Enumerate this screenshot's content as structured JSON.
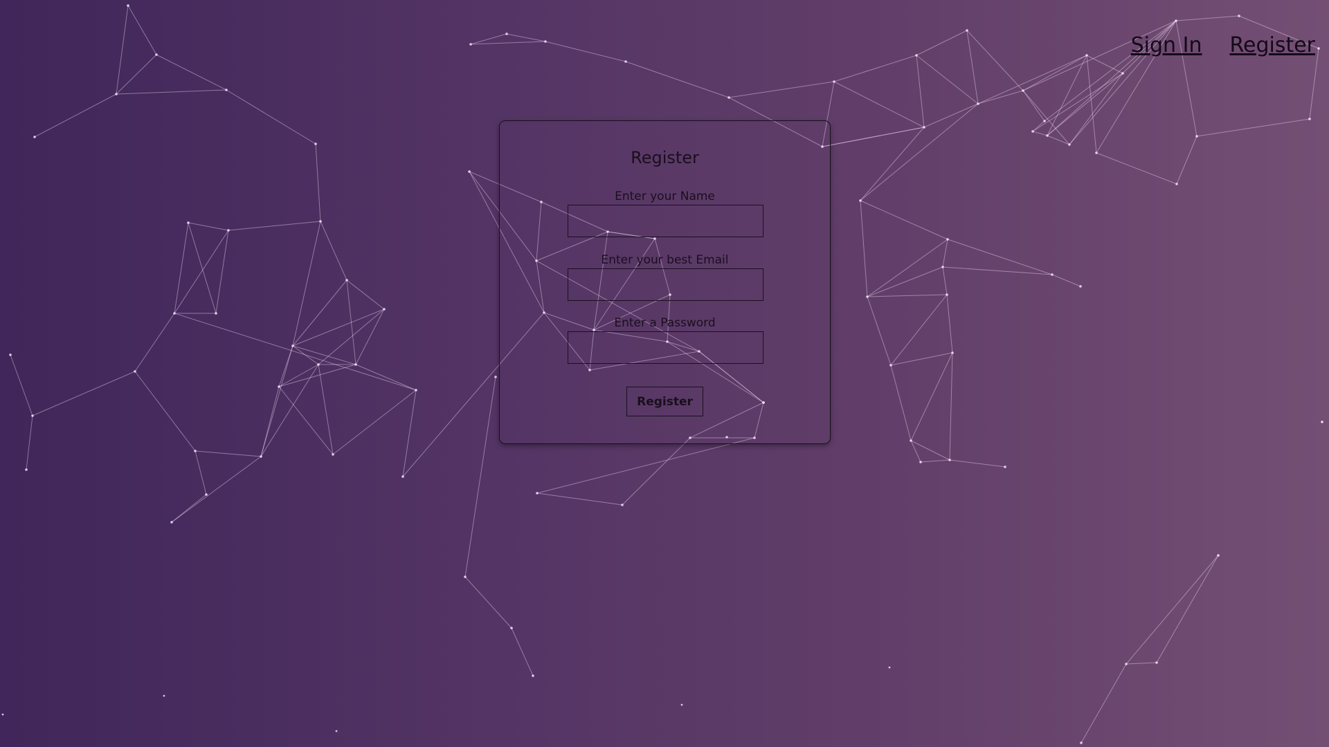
{
  "nav": {
    "sign_in_label": "Sign In",
    "register_label": "Register"
  },
  "form": {
    "title": "Register",
    "name_label": "Enter your Name",
    "name_value": "",
    "email_label": "Enter your best Email",
    "email_value": "",
    "password_label": "Enter a Password",
    "password_value": "",
    "submit_label": "Register"
  }
}
